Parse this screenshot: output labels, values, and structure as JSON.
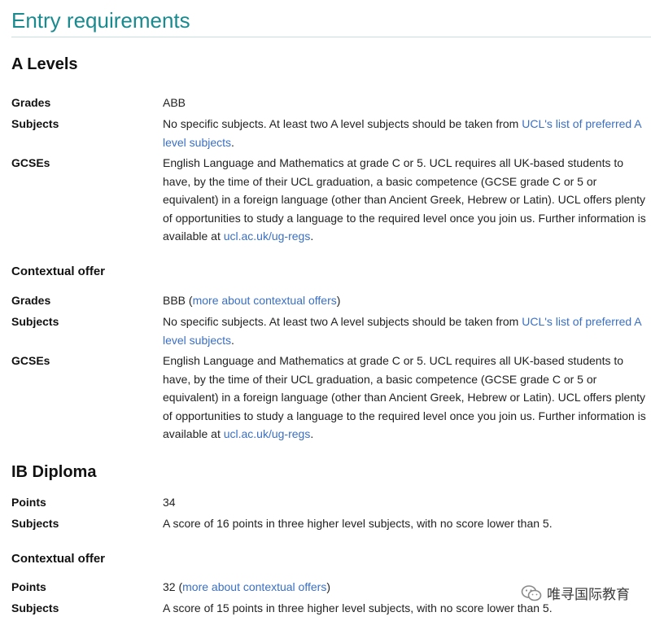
{
  "page_title": "Entry requirements",
  "sections": {
    "a_levels": {
      "heading": "A Levels",
      "standard": {
        "grades_label": "Grades",
        "grades_value": "ABB",
        "subjects_label": "Subjects",
        "subjects_text_before": "No specific subjects. At least two A level subjects should be taken from ",
        "subjects_link": "UCL's list of preferred A level subjects",
        "subjects_text_after": ".",
        "gcses_label": "GCSEs",
        "gcses_text": "English Language and Mathematics at grade C or 5. UCL requires all UK-based students to have, by the time of their UCL graduation, a basic competence (GCSE grade C or 5 or equivalent) in a foreign language (other than Ancient Greek, Hebrew or Latin). UCL offers plenty of opportunities to study a language to the required level once you join us. Further information is available at ",
        "gcses_link": "ucl.ac.uk/ug-regs",
        "gcses_text_after": "."
      },
      "contextual": {
        "heading": "Contextual offer",
        "grades_label": "Grades",
        "grades_value": "BBB",
        "grades_link_open": " (",
        "grades_link": "more about contextual offers",
        "grades_link_close": ")",
        "subjects_label": "Subjects",
        "subjects_text_before": "No specific subjects. At least two A level subjects should be taken from ",
        "subjects_link": "UCL's list of preferred A level subjects",
        "subjects_text_after": ".",
        "gcses_label": "GCSEs",
        "gcses_text": "English Language and Mathematics at grade C or 5. UCL requires all UK-based students to have, by the time of their UCL graduation, a basic competence (GCSE grade C or 5 or equivalent) in a foreign language (other than Ancient Greek, Hebrew or Latin). UCL offers plenty of opportunities to study a language to the required level once you join us. Further information is available at ",
        "gcses_link": "ucl.ac.uk/ug-regs",
        "gcses_text_after": "."
      }
    },
    "ib_diploma": {
      "heading": "IB Diploma",
      "standard": {
        "points_label": "Points",
        "points_value": "34",
        "subjects_label": "Subjects",
        "subjects_text": "A score of 16 points in three higher level subjects, with no score lower than 5."
      },
      "contextual": {
        "heading": "Contextual offer",
        "points_label": "Points",
        "points_value": "32",
        "points_link_open": " (",
        "points_link": "more about contextual offers",
        "points_link_close": ")",
        "subjects_label": "Subjects",
        "subjects_text": "A score of 15 points in three higher level subjects, with no score lower than 5."
      }
    }
  },
  "watermark": {
    "icon": "wechat-icon",
    "text": "唯寻国际教育"
  },
  "colors": {
    "title": "#1a8a8e",
    "link": "#3a6fc4",
    "rule": "#c8dfe0"
  }
}
